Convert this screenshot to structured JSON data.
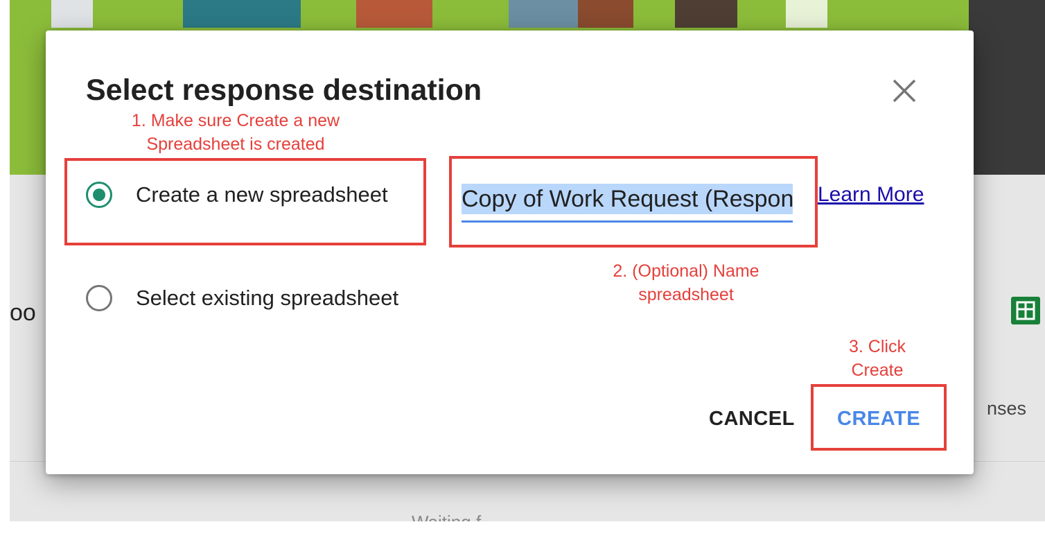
{
  "background": {
    "partial_title": "oo",
    "partial_responses": "nses",
    "partial_bottom": "Waiting f..."
  },
  "dialog": {
    "title": "Select response destination",
    "options": [
      {
        "label": "Create a new spreadsheet",
        "selected": true
      },
      {
        "label": "Select existing spreadsheet",
        "selected": false
      }
    ],
    "spreadsheet_name_value": "Copy of Work Request (Responses)",
    "learn_more_label": "Learn More",
    "cancel_label": "CANCEL",
    "create_label": "CREATE"
  },
  "annotations": {
    "step1": "1. Make sure Create a new Spreadsheet is created",
    "step2": "2. (Optional) Name spreadsheet",
    "step3": "3. Click Create"
  },
  "colors": {
    "accent_blue": "#4a86e8",
    "radio_green": "#1e8e6e",
    "annotation_red": "#e5403b",
    "link_blue": "#1a0dab"
  }
}
